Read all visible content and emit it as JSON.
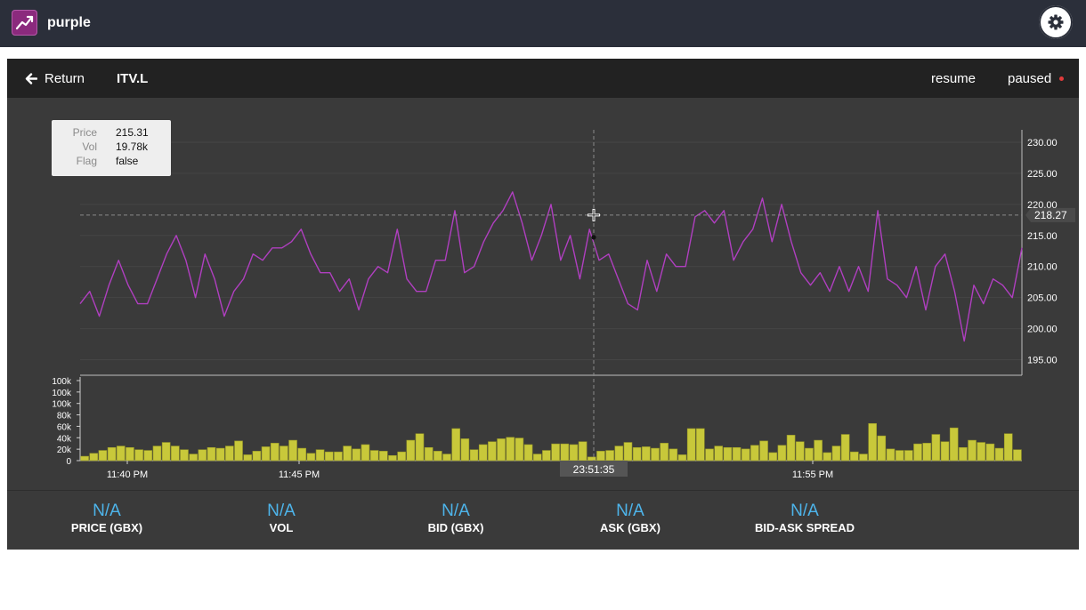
{
  "app": {
    "name": "purple"
  },
  "header": {
    "return_label": "Return",
    "symbol": "ITV.L",
    "resume_label": "resume",
    "paused_label": "paused"
  },
  "tooltip": {
    "rows": [
      {
        "key": "Price",
        "value": "215.31"
      },
      {
        "key": "Vol",
        "value": "19.78k"
      },
      {
        "key": "Flag",
        "value": "false"
      }
    ]
  },
  "chart_data": {
    "type": "line",
    "price_series_color": "#b03fc0",
    "volume_bar_color": "#c8c83a",
    "price_axis_ticks": [
      "230.00",
      "225.00",
      "220.00",
      "215.00",
      "210.00",
      "205.00",
      "200.00",
      "195.00"
    ],
    "price_ylim": [
      192.5,
      232
    ],
    "volume_axis_ticks": [
      "100k",
      "100k",
      "100k",
      "80k",
      "60k",
      "40k",
      "20k",
      "0"
    ],
    "time_ticks": [
      "11:40 PM",
      "11:45 PM",
      "11:55 PM"
    ],
    "crosshair_price_label": "218.27",
    "crosshair_time_label": "23:51:35",
    "price": [
      204,
      206,
      202,
      207,
      211,
      207,
      204,
      204,
      208,
      212,
      215,
      211,
      205,
      212,
      208,
      202,
      206,
      208,
      212,
      211,
      213,
      213,
      214,
      216,
      212,
      209,
      209,
      206,
      208,
      203,
      208,
      210,
      209,
      216,
      208,
      206,
      206,
      211,
      211,
      219,
      209,
      210,
      214,
      217,
      219,
      222,
      217,
      211,
      215,
      220,
      211,
      215,
      208,
      216,
      211,
      212,
      208,
      204,
      203,
      211,
      206,
      212,
      210,
      210,
      218,
      219,
      217,
      219,
      211,
      214,
      216,
      221,
      214,
      220,
      214,
      209,
      207,
      209,
      206,
      210,
      206,
      210,
      206,
      219,
      208,
      207,
      205,
      210,
      203,
      210,
      212,
      206,
      198,
      207,
      204,
      208,
      207,
      205,
      213
    ],
    "volume": [
      6,
      10,
      14,
      18,
      20,
      18,
      15,
      14,
      20,
      25,
      20,
      15,
      9,
      15,
      18,
      17,
      20,
      27,
      8,
      13,
      19,
      24,
      20,
      28,
      17,
      10,
      15,
      12,
      12,
      20,
      16,
      22,
      14,
      13,
      7,
      12,
      28,
      37,
      18,
      13,
      9,
      44,
      30,
      15,
      22,
      26,
      30,
      32,
      31,
      22,
      9,
      14,
      23,
      23,
      22,
      26,
      5,
      13,
      14,
      20,
      25,
      18,
      19,
      17,
      24,
      16,
      8,
      44,
      44,
      16,
      20,
      18,
      18,
      16,
      21,
      27,
      11,
      21,
      35,
      26,
      17,
      28,
      11,
      20,
      36,
      12,
      9,
      51,
      34,
      16,
      14,
      14,
      23,
      24,
      36,
      26,
      45,
      18,
      28,
      25,
      23,
      17,
      37,
      15
    ]
  }
}
